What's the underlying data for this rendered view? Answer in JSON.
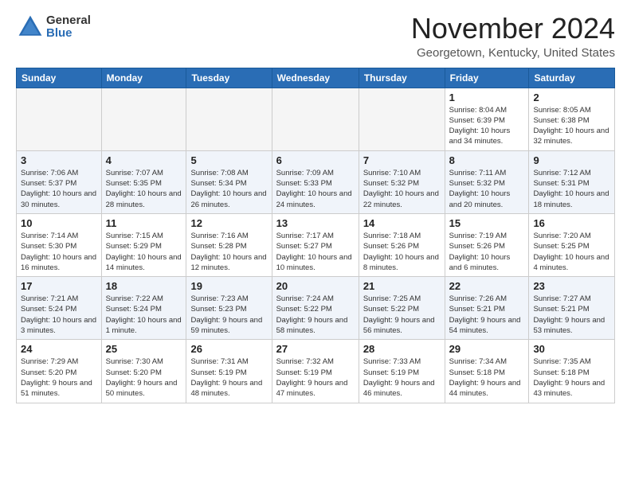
{
  "header": {
    "logo_general": "General",
    "logo_blue": "Blue",
    "month_title": "November 2024",
    "location": "Georgetown, Kentucky, United States"
  },
  "days_of_week": [
    "Sunday",
    "Monday",
    "Tuesday",
    "Wednesday",
    "Thursday",
    "Friday",
    "Saturday"
  ],
  "weeks": [
    [
      {
        "day": "",
        "info": ""
      },
      {
        "day": "",
        "info": ""
      },
      {
        "day": "",
        "info": ""
      },
      {
        "day": "",
        "info": ""
      },
      {
        "day": "",
        "info": ""
      },
      {
        "day": "1",
        "info": "Sunrise: 8:04 AM\nSunset: 6:39 PM\nDaylight: 10 hours and 34 minutes."
      },
      {
        "day": "2",
        "info": "Sunrise: 8:05 AM\nSunset: 6:38 PM\nDaylight: 10 hours and 32 minutes."
      }
    ],
    [
      {
        "day": "3",
        "info": "Sunrise: 7:06 AM\nSunset: 5:37 PM\nDaylight: 10 hours and 30 minutes."
      },
      {
        "day": "4",
        "info": "Sunrise: 7:07 AM\nSunset: 5:35 PM\nDaylight: 10 hours and 28 minutes."
      },
      {
        "day": "5",
        "info": "Sunrise: 7:08 AM\nSunset: 5:34 PM\nDaylight: 10 hours and 26 minutes."
      },
      {
        "day": "6",
        "info": "Sunrise: 7:09 AM\nSunset: 5:33 PM\nDaylight: 10 hours and 24 minutes."
      },
      {
        "day": "7",
        "info": "Sunrise: 7:10 AM\nSunset: 5:32 PM\nDaylight: 10 hours and 22 minutes."
      },
      {
        "day": "8",
        "info": "Sunrise: 7:11 AM\nSunset: 5:32 PM\nDaylight: 10 hours and 20 minutes."
      },
      {
        "day": "9",
        "info": "Sunrise: 7:12 AM\nSunset: 5:31 PM\nDaylight: 10 hours and 18 minutes."
      }
    ],
    [
      {
        "day": "10",
        "info": "Sunrise: 7:14 AM\nSunset: 5:30 PM\nDaylight: 10 hours and 16 minutes."
      },
      {
        "day": "11",
        "info": "Sunrise: 7:15 AM\nSunset: 5:29 PM\nDaylight: 10 hours and 14 minutes."
      },
      {
        "day": "12",
        "info": "Sunrise: 7:16 AM\nSunset: 5:28 PM\nDaylight: 10 hours and 12 minutes."
      },
      {
        "day": "13",
        "info": "Sunrise: 7:17 AM\nSunset: 5:27 PM\nDaylight: 10 hours and 10 minutes."
      },
      {
        "day": "14",
        "info": "Sunrise: 7:18 AM\nSunset: 5:26 PM\nDaylight: 10 hours and 8 minutes."
      },
      {
        "day": "15",
        "info": "Sunrise: 7:19 AM\nSunset: 5:26 PM\nDaylight: 10 hours and 6 minutes."
      },
      {
        "day": "16",
        "info": "Sunrise: 7:20 AM\nSunset: 5:25 PM\nDaylight: 10 hours and 4 minutes."
      }
    ],
    [
      {
        "day": "17",
        "info": "Sunrise: 7:21 AM\nSunset: 5:24 PM\nDaylight: 10 hours and 3 minutes."
      },
      {
        "day": "18",
        "info": "Sunrise: 7:22 AM\nSunset: 5:24 PM\nDaylight: 10 hours and 1 minute."
      },
      {
        "day": "19",
        "info": "Sunrise: 7:23 AM\nSunset: 5:23 PM\nDaylight: 9 hours and 59 minutes."
      },
      {
        "day": "20",
        "info": "Sunrise: 7:24 AM\nSunset: 5:22 PM\nDaylight: 9 hours and 58 minutes."
      },
      {
        "day": "21",
        "info": "Sunrise: 7:25 AM\nSunset: 5:22 PM\nDaylight: 9 hours and 56 minutes."
      },
      {
        "day": "22",
        "info": "Sunrise: 7:26 AM\nSunset: 5:21 PM\nDaylight: 9 hours and 54 minutes."
      },
      {
        "day": "23",
        "info": "Sunrise: 7:27 AM\nSunset: 5:21 PM\nDaylight: 9 hours and 53 minutes."
      }
    ],
    [
      {
        "day": "24",
        "info": "Sunrise: 7:29 AM\nSunset: 5:20 PM\nDaylight: 9 hours and 51 minutes."
      },
      {
        "day": "25",
        "info": "Sunrise: 7:30 AM\nSunset: 5:20 PM\nDaylight: 9 hours and 50 minutes."
      },
      {
        "day": "26",
        "info": "Sunrise: 7:31 AM\nSunset: 5:19 PM\nDaylight: 9 hours and 48 minutes."
      },
      {
        "day": "27",
        "info": "Sunrise: 7:32 AM\nSunset: 5:19 PM\nDaylight: 9 hours and 47 minutes."
      },
      {
        "day": "28",
        "info": "Sunrise: 7:33 AM\nSunset: 5:19 PM\nDaylight: 9 hours and 46 minutes."
      },
      {
        "day": "29",
        "info": "Sunrise: 7:34 AM\nSunset: 5:18 PM\nDaylight: 9 hours and 44 minutes."
      },
      {
        "day": "30",
        "info": "Sunrise: 7:35 AM\nSunset: 5:18 PM\nDaylight: 9 hours and 43 minutes."
      }
    ]
  ]
}
